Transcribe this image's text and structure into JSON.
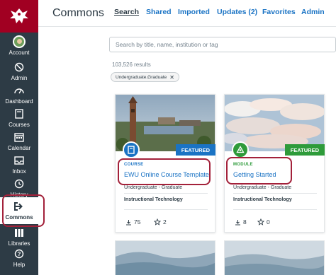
{
  "nav": {
    "items": [
      {
        "label": "Account",
        "icon": "avatar"
      },
      {
        "label": "Admin",
        "icon": "shield-icon"
      },
      {
        "label": "Dashboard",
        "icon": "dashboard-icon"
      },
      {
        "label": "Courses",
        "icon": "book-icon"
      },
      {
        "label": "Calendar",
        "icon": "calendar-icon"
      },
      {
        "label": "Inbox",
        "icon": "inbox-icon"
      },
      {
        "label": "History",
        "icon": "clock-icon"
      },
      {
        "label": "Commons",
        "icon": "share-icon"
      },
      {
        "label": "Libraries",
        "icon": "library-icon"
      },
      {
        "label": "Help",
        "icon": "help-icon"
      }
    ]
  },
  "header": {
    "title": "Commons",
    "tabs": [
      "Search",
      "Shared",
      "Imported",
      "Updates (2)",
      "Favorites",
      "Admin"
    ]
  },
  "search": {
    "placeholder": "Search by title, name, institution or tag",
    "results": "103,526 results",
    "filter_chip": "Undergraduate,Graduate"
  },
  "cards": [
    {
      "badge": "FEATURED",
      "type": "COURSE",
      "title": "EWU Online Course Template",
      "level": "Undergraduate - Graduate",
      "org": "Instructional Technology",
      "downloads": "75",
      "favorites": "2"
    },
    {
      "badge": "FEATURED",
      "type": "MODULE",
      "title": "Getting Started",
      "level": "Undergraduate - Graduate",
      "org": "Instructional Technology",
      "downloads": "8",
      "favorites": "0"
    }
  ],
  "colors": {
    "nav_bg": "#2d3b45",
    "brand": "#a10022",
    "highlight": "#a3213a",
    "course": "#1a73c4",
    "module": "#2e9b3a",
    "link": "#1a73c4"
  }
}
